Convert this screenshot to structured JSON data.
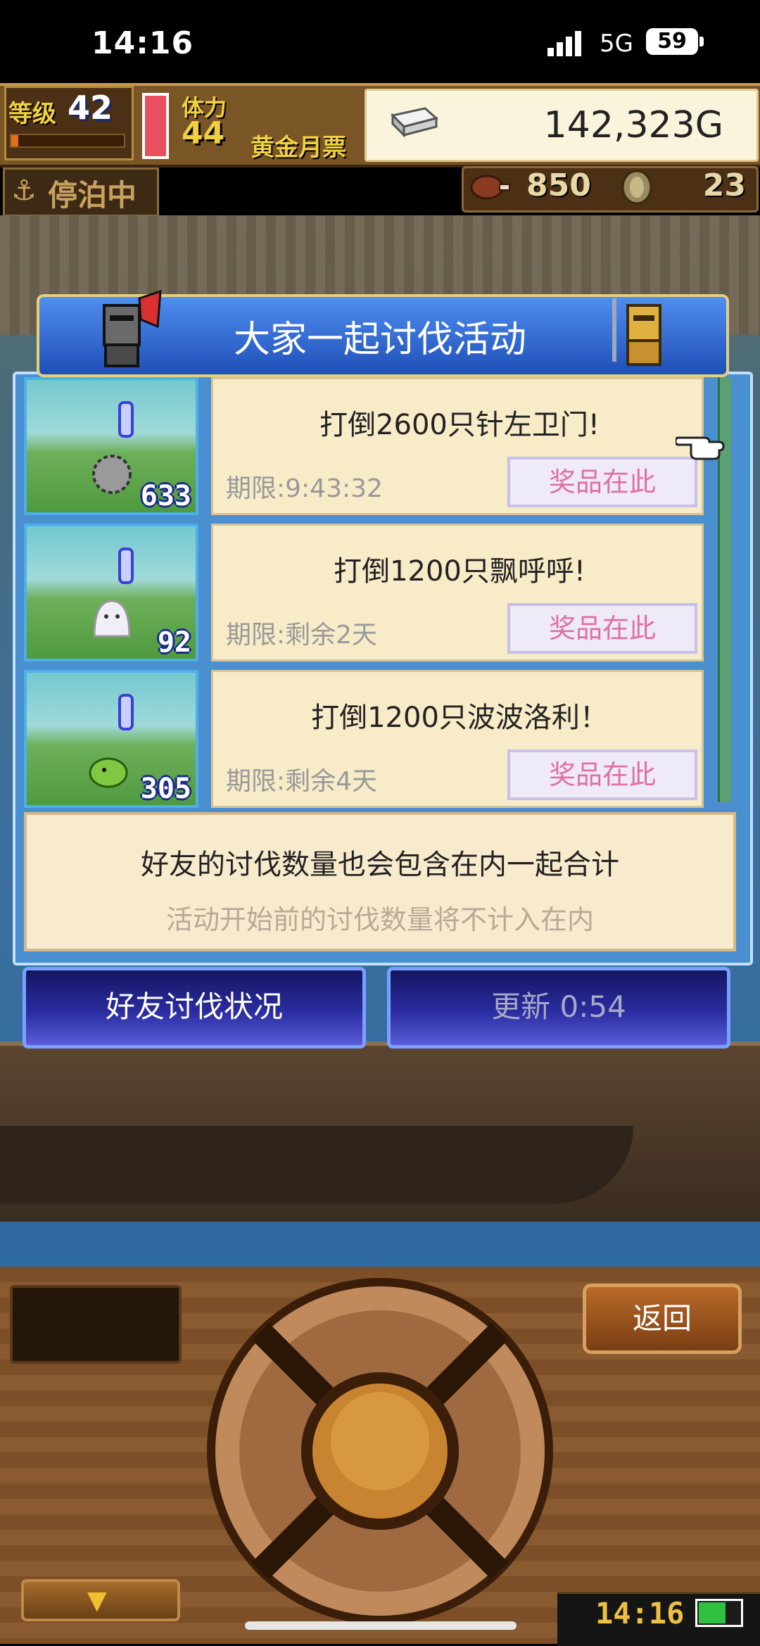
{
  "status_bar": {
    "time": "14:16",
    "network": "5G",
    "battery": "59"
  },
  "hud": {
    "level_label": "等级",
    "level_value": "42",
    "level_progress": 0.06,
    "stamina_label": "体力",
    "stamina_value": "44",
    "pass_label": "黄金月票",
    "gold": "142,323G",
    "dock_status": "停泊中",
    "food": "850",
    "medals": "23",
    "icons": [
      "anchor-icon",
      "gold-bar-icon",
      "meat-icon",
      "coin-icon"
    ]
  },
  "dialog": {
    "title": "大家一起讨伐活动",
    "missions": [
      {
        "goal": "打倒2600只针左卫门!",
        "deadline": "期限:9:43:32",
        "prize": "奖品在此",
        "count": "633"
      },
      {
        "goal": "打倒1200只飘呼呼!",
        "deadline": "期限:剩余2天",
        "prize": "奖品在此",
        "count": "92"
      },
      {
        "goal": "打倒1200只波波洛利！",
        "deadline": "期限:剩余4天",
        "prize": "奖品在此",
        "count": "305"
      }
    ],
    "note_line1": "好友的讨伐数量也会包含在内一起合计",
    "note_line2": "活动开始前的讨伐数量将不计入在内",
    "friend_button": "好友讨伐状况",
    "refresh_button": "更新 0:54"
  },
  "controls": {
    "back_label": "返回",
    "clock": "14:16",
    "down_arrow": "▼"
  },
  "colors": {
    "title_blue": "#2f63d2",
    "prize_pink": "#e070a0",
    "button_navy": "#1e2090",
    "hud_gold": "#f0d040"
  }
}
